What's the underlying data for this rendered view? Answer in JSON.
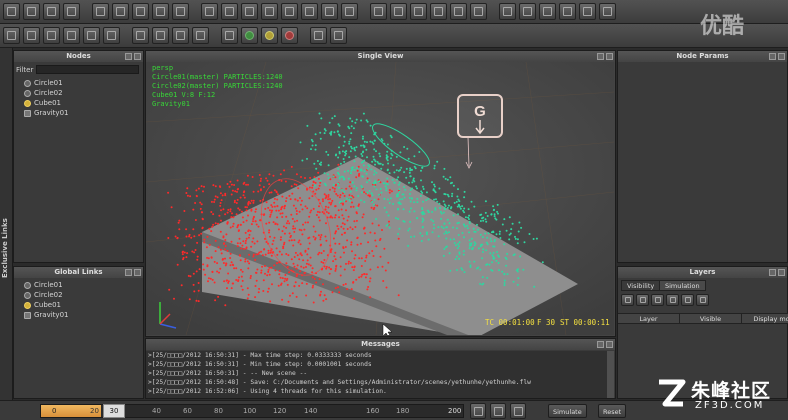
{
  "watermark_top": "优酷",
  "watermark_bottom": {
    "site": "朱峰社区",
    "url": "ZF3D.COM"
  },
  "panels": {
    "nodes": {
      "title": "Nodes",
      "filter_label": "Filter",
      "items": [
        {
          "label": "Circle01",
          "icon": "emitter-icon"
        },
        {
          "label": "Circle02",
          "icon": "emitter-icon"
        },
        {
          "label": "Cube01",
          "icon": "cube-icon"
        },
        {
          "label": "Gravity01",
          "icon": "gravity-icon"
        }
      ]
    },
    "global_links": {
      "title": "Global Links",
      "items": [
        {
          "label": "Circle01",
          "icon": "emitter-icon"
        },
        {
          "label": "Circle02",
          "icon": "emitter-icon"
        },
        {
          "label": "Cube01",
          "icon": "cube-icon"
        },
        {
          "label": "Gravity01",
          "icon": "gravity-icon"
        }
      ]
    },
    "exclusive_links": {
      "title": "Exclusive Links"
    },
    "viewport": {
      "title": "Single View",
      "hud_lines": [
        "persp",
        "Circle01(master) PARTICLES:1240",
        "Circle02(master) PARTICLES:1240",
        "Cube01 V:8 F:12",
        "Gravity01"
      ],
      "gravity_label": "G",
      "timecode": "TC 00:01:00",
      "frame": "F 30",
      "sim_time": "ST 00:00:11"
    },
    "node_params": {
      "title": "Node Params"
    },
    "layers": {
      "title": "Layers",
      "tabs": [
        "Visibility",
        "Simulation"
      ],
      "columns": [
        "Layer",
        "Visible",
        "Display mo"
      ]
    },
    "messages": {
      "title": "Messages",
      "lines": [
        ">[25/□□□□/2012 16:50:31] - Max time step: 0.0333333 seconds",
        ">[25/□□□□/2012 16:50:31] - Min time step: 0.0001001 seconds",
        ">[25/□□□□/2012 16:50:31] - -- New scene --",
        ">[25/□□□□/2012 16:50:48] - Save: C:/Documents and Settings/Administrator/scenes/yethunhe/yethunhe.flw",
        ">[25/□□□□/2012 16:52:06] - Using 4 threads for this simulation."
      ]
    }
  },
  "timeline": {
    "start_value": "0",
    "range_end": "20",
    "current_frame": "30",
    "ticks": [
      "40",
      "60",
      "80",
      "100",
      "120",
      "140",
      "160",
      "180",
      "200"
    ],
    "simulate_label": "Simulate",
    "reset_label": "Reset"
  },
  "colors": {
    "particles_red": "#ff2a2a",
    "particles_teal": "#2fd6a0",
    "hud_green": "#38d838",
    "timecode_yellow": "#f4e040",
    "timeline_range": "#e8a64a"
  }
}
